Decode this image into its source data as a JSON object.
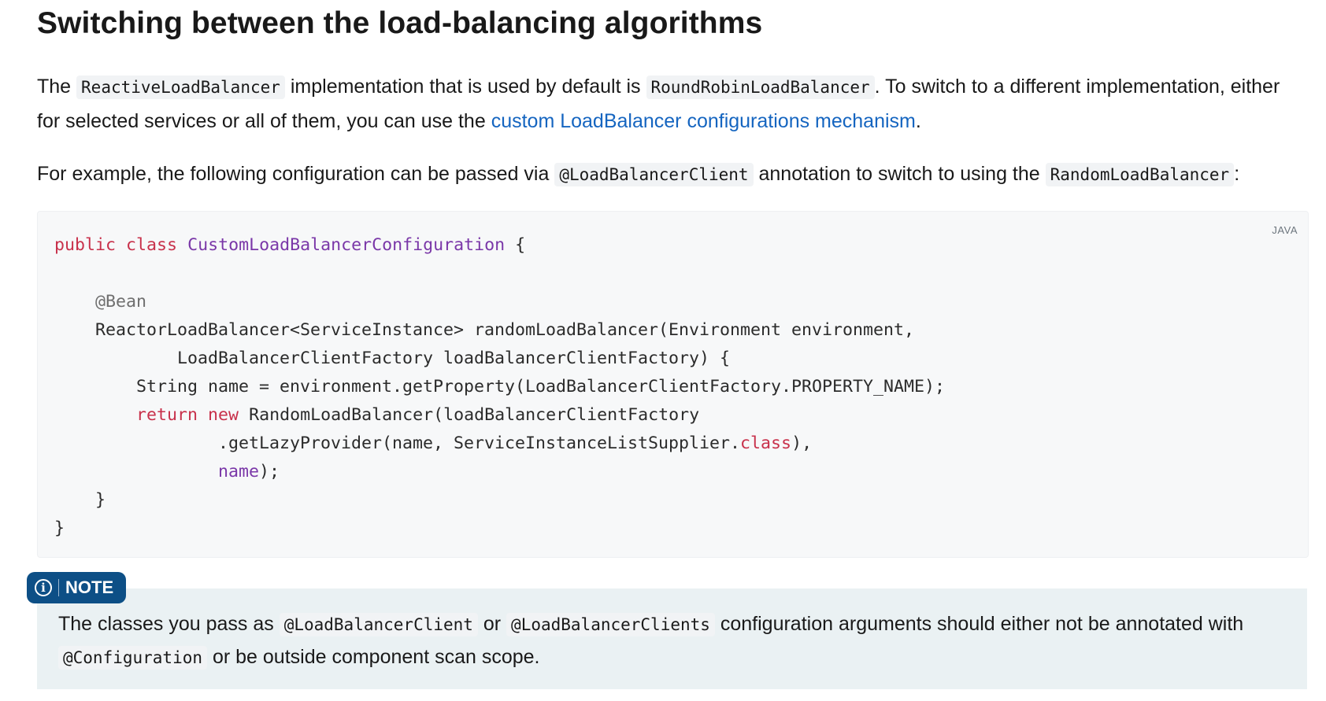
{
  "heading": "Switching between the load-balancing algorithms",
  "para1": {
    "t1": "The ",
    "c1": "ReactiveLoadBalancer",
    "t2": " implementation that is used by default is ",
    "c2": "RoundRobinLoadBalancer",
    "t3": ". To switch to a different implementation, ei­ther for selected services or all of them, you can use the ",
    "link": "custom LoadBalancer configurations mechanism",
    "t4": "."
  },
  "para2": {
    "t1": "For example, the following configuration can be passed via ",
    "c1": "@LoadBalancerClient",
    "t2": " annotation to switch to using the ",
    "c2": "RandomLoadBalancer",
    "t3": ":"
  },
  "code": {
    "language": "JAVA",
    "l1_kw1": "public",
    "l1_kw2": "class",
    "l1_cls": "CustomLoadBalancerConfiguration",
    "l1_rest": " {",
    "l3_ann": "@Bean",
    "l4": "ReactorLoadBalancer<ServiceInstance> randomLoadBalancer(Environment environment,",
    "l5": "LoadBalancerClientFactory loadBalancerClientFactory) {",
    "l6": "String name = environment.getProperty(LoadBalancerClientFactory.PROPERTY_NAME);",
    "l7_kw1": "return",
    "l7_kw2": "new",
    "l7_rest": " RandomLoadBalancer(loadBalancerClientFactory",
    "l8_a": ".getLazyProvider(name, ServiceInstanceListSupplier.",
    "l8_kw": "class",
    "l8_b": "),",
    "l9_prop": "name",
    "l9_rest": ");",
    "l10": "}",
    "l11": "}"
  },
  "note": {
    "label": "NOTE",
    "t1": "The classes you pass as ",
    "c1": "@LoadBalancerClient",
    "t2": " or ",
    "c2": "@LoadBalancerClients",
    "t3": " configuration arguments should either not be annotated with ",
    "c3": "@Configuration",
    "t4": " or be outside component scan scope."
  }
}
